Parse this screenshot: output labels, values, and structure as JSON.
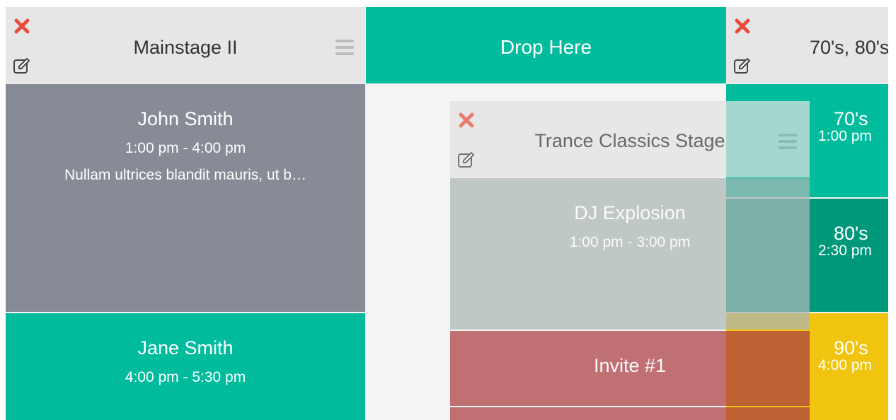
{
  "columns": [
    {
      "title": "Mainstage II",
      "slots": [
        {
          "name": "John Smith",
          "time": "1:00 pm - 4:00 pm",
          "desc": "Nullam ultrices blandit mauris, ut b…",
          "color": "#878b96"
        },
        {
          "name": "Jane Smith",
          "time": "4:00 pm - 5:30 pm",
          "color": "#00bc9d"
        }
      ]
    },
    {
      "title": "70's, 80's",
      "slots": [
        {
          "name": "70's",
          "time": "1:00 pm",
          "color": "#00bc9d"
        },
        {
          "name": "80's",
          "time": "2:30 pm",
          "color": "#00987b"
        },
        {
          "name": "90's",
          "time": "4:00 pm",
          "color": "#f1c40f"
        }
      ]
    }
  ],
  "drop_zone": {
    "label": "Drop Here"
  },
  "dragging": {
    "title": "Trance Classics Stage",
    "slots": [
      {
        "name": "DJ Explosion",
        "time": "1:00 pm - 3:00 pm",
        "color": "#acb8b6"
      },
      {
        "name": "Invite #1",
        "color": "#ad3d42"
      },
      {
        "color": "#ad3d42"
      }
    ]
  },
  "colors": {
    "accent": "#00bc9d",
    "delete": "#e74c3c",
    "header": "#e6e6e6",
    "board": "#f4f4f4"
  }
}
